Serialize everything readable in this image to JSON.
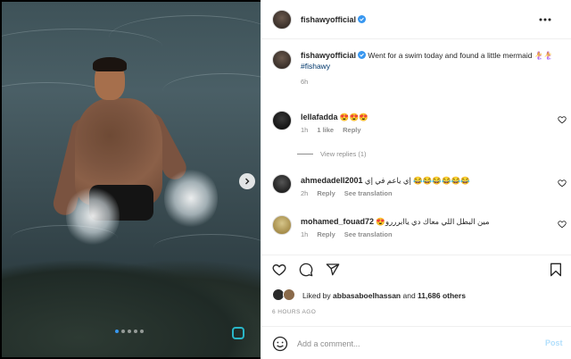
{
  "post": {
    "username": "fishawyofficial",
    "verified_color": "#3897f0",
    "caption_text": "Went for a swim today and found a little mermaid 🧜‍♀️🧜‍♀️",
    "hashtag": "#fishawy",
    "caption_time": "6h",
    "carousel": {
      "total_slides": 5,
      "active_slide": 1
    }
  },
  "comments": [
    {
      "username": "lellafadda",
      "text": "😍😍😍",
      "time": "1h",
      "likes": "1 like",
      "reply": "Reply",
      "view_replies": "View replies (1)"
    },
    {
      "username": "ahmedadell2001",
      "text": "إي ياعم في إي 😂😂😂😂😂😂",
      "time": "2h",
      "reply": "Reply",
      "translate": "See translation"
    },
    {
      "username": "mohamed_fouad72",
      "text": "😍مين البطل اللي معاك دي ياابرررو",
      "time": "1h",
      "reply": "Reply",
      "translate": "See translation"
    }
  ],
  "likes": {
    "prefix": "Liked by",
    "user": "abbasaboelhassan",
    "joiner": "and",
    "others": "11,686 others"
  },
  "post_time": "6 HOURS AGO",
  "comment_box": {
    "placeholder": "Add a comment...",
    "post_label": "Post"
  },
  "icons": {
    "more": "more-horizontal-icon",
    "verified": "verified-badge-icon",
    "heart": "heart-icon",
    "comment": "comment-icon",
    "share": "share-icon",
    "bookmark": "bookmark-icon",
    "emoji": "emoji-icon",
    "next": "chevron-right-icon"
  }
}
